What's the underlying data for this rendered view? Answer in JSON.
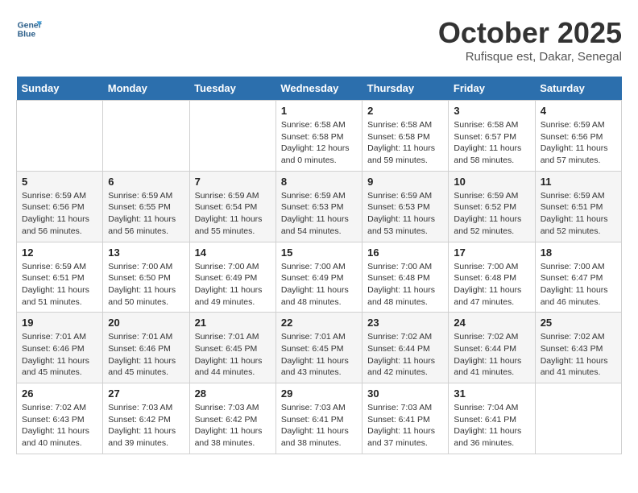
{
  "header": {
    "logo_line1": "General",
    "logo_line2": "Blue",
    "month_title": "October 2025",
    "subtitle": "Rufisque est, Dakar, Senegal"
  },
  "days_of_week": [
    "Sunday",
    "Monday",
    "Tuesday",
    "Wednesday",
    "Thursday",
    "Friday",
    "Saturday"
  ],
  "weeks": [
    [
      {
        "day": "",
        "info": ""
      },
      {
        "day": "",
        "info": ""
      },
      {
        "day": "",
        "info": ""
      },
      {
        "day": "1",
        "info": "Sunrise: 6:58 AM\nSunset: 6:58 PM\nDaylight: 12 hours\nand 0 minutes."
      },
      {
        "day": "2",
        "info": "Sunrise: 6:58 AM\nSunset: 6:58 PM\nDaylight: 11 hours\nand 59 minutes."
      },
      {
        "day": "3",
        "info": "Sunrise: 6:58 AM\nSunset: 6:57 PM\nDaylight: 11 hours\nand 58 minutes."
      },
      {
        "day": "4",
        "info": "Sunrise: 6:59 AM\nSunset: 6:56 PM\nDaylight: 11 hours\nand 57 minutes."
      }
    ],
    [
      {
        "day": "5",
        "info": "Sunrise: 6:59 AM\nSunset: 6:56 PM\nDaylight: 11 hours\nand 56 minutes."
      },
      {
        "day": "6",
        "info": "Sunrise: 6:59 AM\nSunset: 6:55 PM\nDaylight: 11 hours\nand 56 minutes."
      },
      {
        "day": "7",
        "info": "Sunrise: 6:59 AM\nSunset: 6:54 PM\nDaylight: 11 hours\nand 55 minutes."
      },
      {
        "day": "8",
        "info": "Sunrise: 6:59 AM\nSunset: 6:53 PM\nDaylight: 11 hours\nand 54 minutes."
      },
      {
        "day": "9",
        "info": "Sunrise: 6:59 AM\nSunset: 6:53 PM\nDaylight: 11 hours\nand 53 minutes."
      },
      {
        "day": "10",
        "info": "Sunrise: 6:59 AM\nSunset: 6:52 PM\nDaylight: 11 hours\nand 52 minutes."
      },
      {
        "day": "11",
        "info": "Sunrise: 6:59 AM\nSunset: 6:51 PM\nDaylight: 11 hours\nand 52 minutes."
      }
    ],
    [
      {
        "day": "12",
        "info": "Sunrise: 6:59 AM\nSunset: 6:51 PM\nDaylight: 11 hours\nand 51 minutes."
      },
      {
        "day": "13",
        "info": "Sunrise: 7:00 AM\nSunset: 6:50 PM\nDaylight: 11 hours\nand 50 minutes."
      },
      {
        "day": "14",
        "info": "Sunrise: 7:00 AM\nSunset: 6:49 PM\nDaylight: 11 hours\nand 49 minutes."
      },
      {
        "day": "15",
        "info": "Sunrise: 7:00 AM\nSunset: 6:49 PM\nDaylight: 11 hours\nand 48 minutes."
      },
      {
        "day": "16",
        "info": "Sunrise: 7:00 AM\nSunset: 6:48 PM\nDaylight: 11 hours\nand 48 minutes."
      },
      {
        "day": "17",
        "info": "Sunrise: 7:00 AM\nSunset: 6:48 PM\nDaylight: 11 hours\nand 47 minutes."
      },
      {
        "day": "18",
        "info": "Sunrise: 7:00 AM\nSunset: 6:47 PM\nDaylight: 11 hours\nand 46 minutes."
      }
    ],
    [
      {
        "day": "19",
        "info": "Sunrise: 7:01 AM\nSunset: 6:46 PM\nDaylight: 11 hours\nand 45 minutes."
      },
      {
        "day": "20",
        "info": "Sunrise: 7:01 AM\nSunset: 6:46 PM\nDaylight: 11 hours\nand 45 minutes."
      },
      {
        "day": "21",
        "info": "Sunrise: 7:01 AM\nSunset: 6:45 PM\nDaylight: 11 hours\nand 44 minutes."
      },
      {
        "day": "22",
        "info": "Sunrise: 7:01 AM\nSunset: 6:45 PM\nDaylight: 11 hours\nand 43 minutes."
      },
      {
        "day": "23",
        "info": "Sunrise: 7:02 AM\nSunset: 6:44 PM\nDaylight: 11 hours\nand 42 minutes."
      },
      {
        "day": "24",
        "info": "Sunrise: 7:02 AM\nSunset: 6:44 PM\nDaylight: 11 hours\nand 41 minutes."
      },
      {
        "day": "25",
        "info": "Sunrise: 7:02 AM\nSunset: 6:43 PM\nDaylight: 11 hours\nand 41 minutes."
      }
    ],
    [
      {
        "day": "26",
        "info": "Sunrise: 7:02 AM\nSunset: 6:43 PM\nDaylight: 11 hours\nand 40 minutes."
      },
      {
        "day": "27",
        "info": "Sunrise: 7:03 AM\nSunset: 6:42 PM\nDaylight: 11 hours\nand 39 minutes."
      },
      {
        "day": "28",
        "info": "Sunrise: 7:03 AM\nSunset: 6:42 PM\nDaylight: 11 hours\nand 38 minutes."
      },
      {
        "day": "29",
        "info": "Sunrise: 7:03 AM\nSunset: 6:41 PM\nDaylight: 11 hours\nand 38 minutes."
      },
      {
        "day": "30",
        "info": "Sunrise: 7:03 AM\nSunset: 6:41 PM\nDaylight: 11 hours\nand 37 minutes."
      },
      {
        "day": "31",
        "info": "Sunrise: 7:04 AM\nSunset: 6:41 PM\nDaylight: 11 hours\nand 36 minutes."
      },
      {
        "day": "",
        "info": ""
      }
    ]
  ]
}
